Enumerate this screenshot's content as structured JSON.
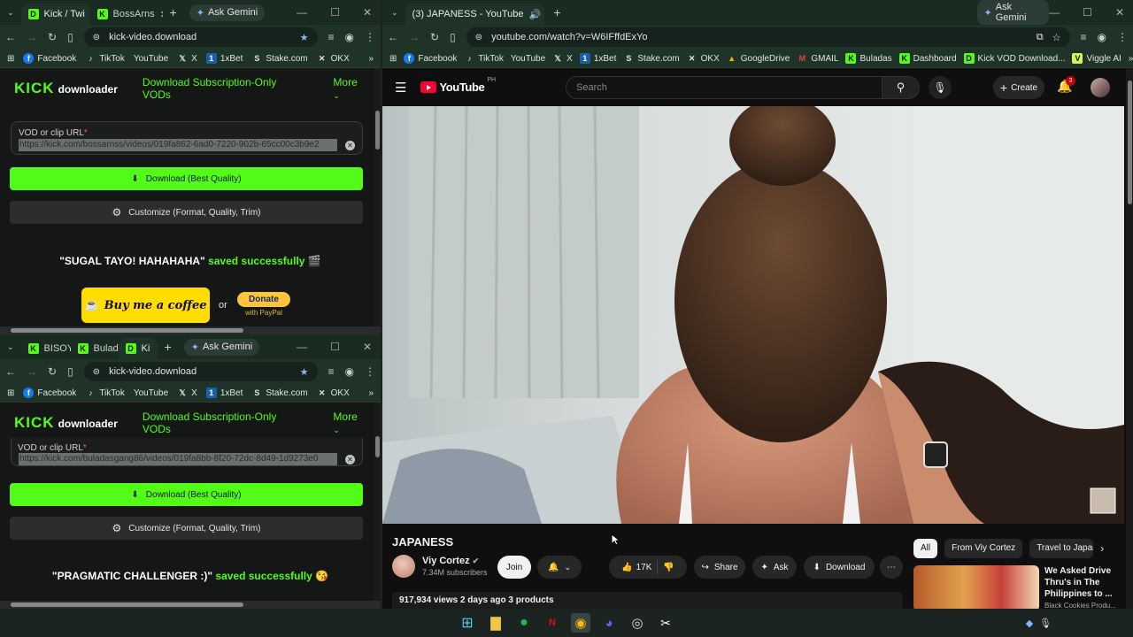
{
  "left_top": {
    "tabs": [
      {
        "label": "Kick / Twi",
        "icon": "kick"
      },
      {
        "label": "BossArns",
        "icon": "kick"
      }
    ],
    "ask_gemini": "Ask Gemini",
    "url": "kick-video.download",
    "bookmarks": [
      "Facebook",
      "TikTok",
      "YouTube",
      "X",
      "1xBet",
      "Stake.com",
      "OKX"
    ],
    "logo_kick": "KICK",
    "logo_downloader": "downloader",
    "nav_sub": "Download Subscription-Only VODs",
    "nav_more": "More",
    "field_label": "VOD or clip URL",
    "field_value": "https://kick.com/bossarnss/videos/019fa862-6ad0-7220-902b-65cc00c3b9e2",
    "download_label": "Download (Best Quality)",
    "customize_label": "Customize (Format, Quality, Trim)",
    "saved_name": "\"SUGAL TAYO! HAHAHAHA\"",
    "saved_text": "saved successfully",
    "saved_emoji": "🎬",
    "coffee_label": "Buy me a coffee",
    "or": "or",
    "donate": "Donate",
    "with_paypal": "with PayPal"
  },
  "left_bottom": {
    "tabs": [
      {
        "label": "BISOY",
        "icon": "kick"
      },
      {
        "label": "Bulada",
        "icon": "kick"
      },
      {
        "label": "Ki",
        "icon": "kick"
      }
    ],
    "ask_gemini": "Ask Gemini",
    "url": "kick-video.download",
    "bookmarks": [
      "Facebook",
      "TikTok",
      "YouTube",
      "X",
      "1xBet",
      "Stake.com",
      "OKX"
    ],
    "logo_kick": "KICK",
    "logo_downloader": "downloader",
    "nav_sub": "Download Subscription-Only VODs",
    "nav_more": "More",
    "field_label": "VOD or clip URL",
    "field_value": "https://kick.com/buladasgang86/videos/019fa8bb-8f20-72dc-8d49-1d9273e0",
    "download_label": "Download (Best Quality)",
    "customize_label": "Customize (Format, Quality, Trim)",
    "saved_name": "\"PRAGMATIC CHALLENGER :)\"",
    "saved_text": "saved successfully",
    "saved_emoji": "😘"
  },
  "right": {
    "tab_label": "(3) JAPANESS - YouTube",
    "ask_gemini": "Ask Gemini",
    "url": "youtube.com/watch?v=W6IFffdExYo",
    "bookmarks": [
      "Facebook",
      "TikTok",
      "YouTube",
      "X",
      "1xBet",
      "Stake.com",
      "OKX",
      "GoogleDrive",
      "GMAIL",
      "Buladas",
      "Dashboard",
      "Kick VOD Download...",
      "Viggle AI"
    ],
    "yt_word": "YouTube",
    "yt_country": "PH",
    "search_placeholder": "Search",
    "create": "Create",
    "notif_count": "3",
    "video_title": "JAPANESS",
    "channel_name": "Viy Cortez",
    "subscribers": "7.34M subscribers",
    "join": "Join",
    "likes": "17K",
    "share": "Share",
    "ask": "Ask",
    "download": "Download",
    "meta": "917,934 views  2 days ago  3 products",
    "chips": [
      "All",
      "From Viy Cortez",
      "Travel to Japan"
    ],
    "rec_title": "We Asked Drive Thru's in The Philippines to ...",
    "rec_channel": "Black Cookies Produ..."
  },
  "colors": {
    "kick_green": "#53fc18",
    "youtube_red": "#ff0033",
    "chrome_frame": "#1f3328"
  }
}
